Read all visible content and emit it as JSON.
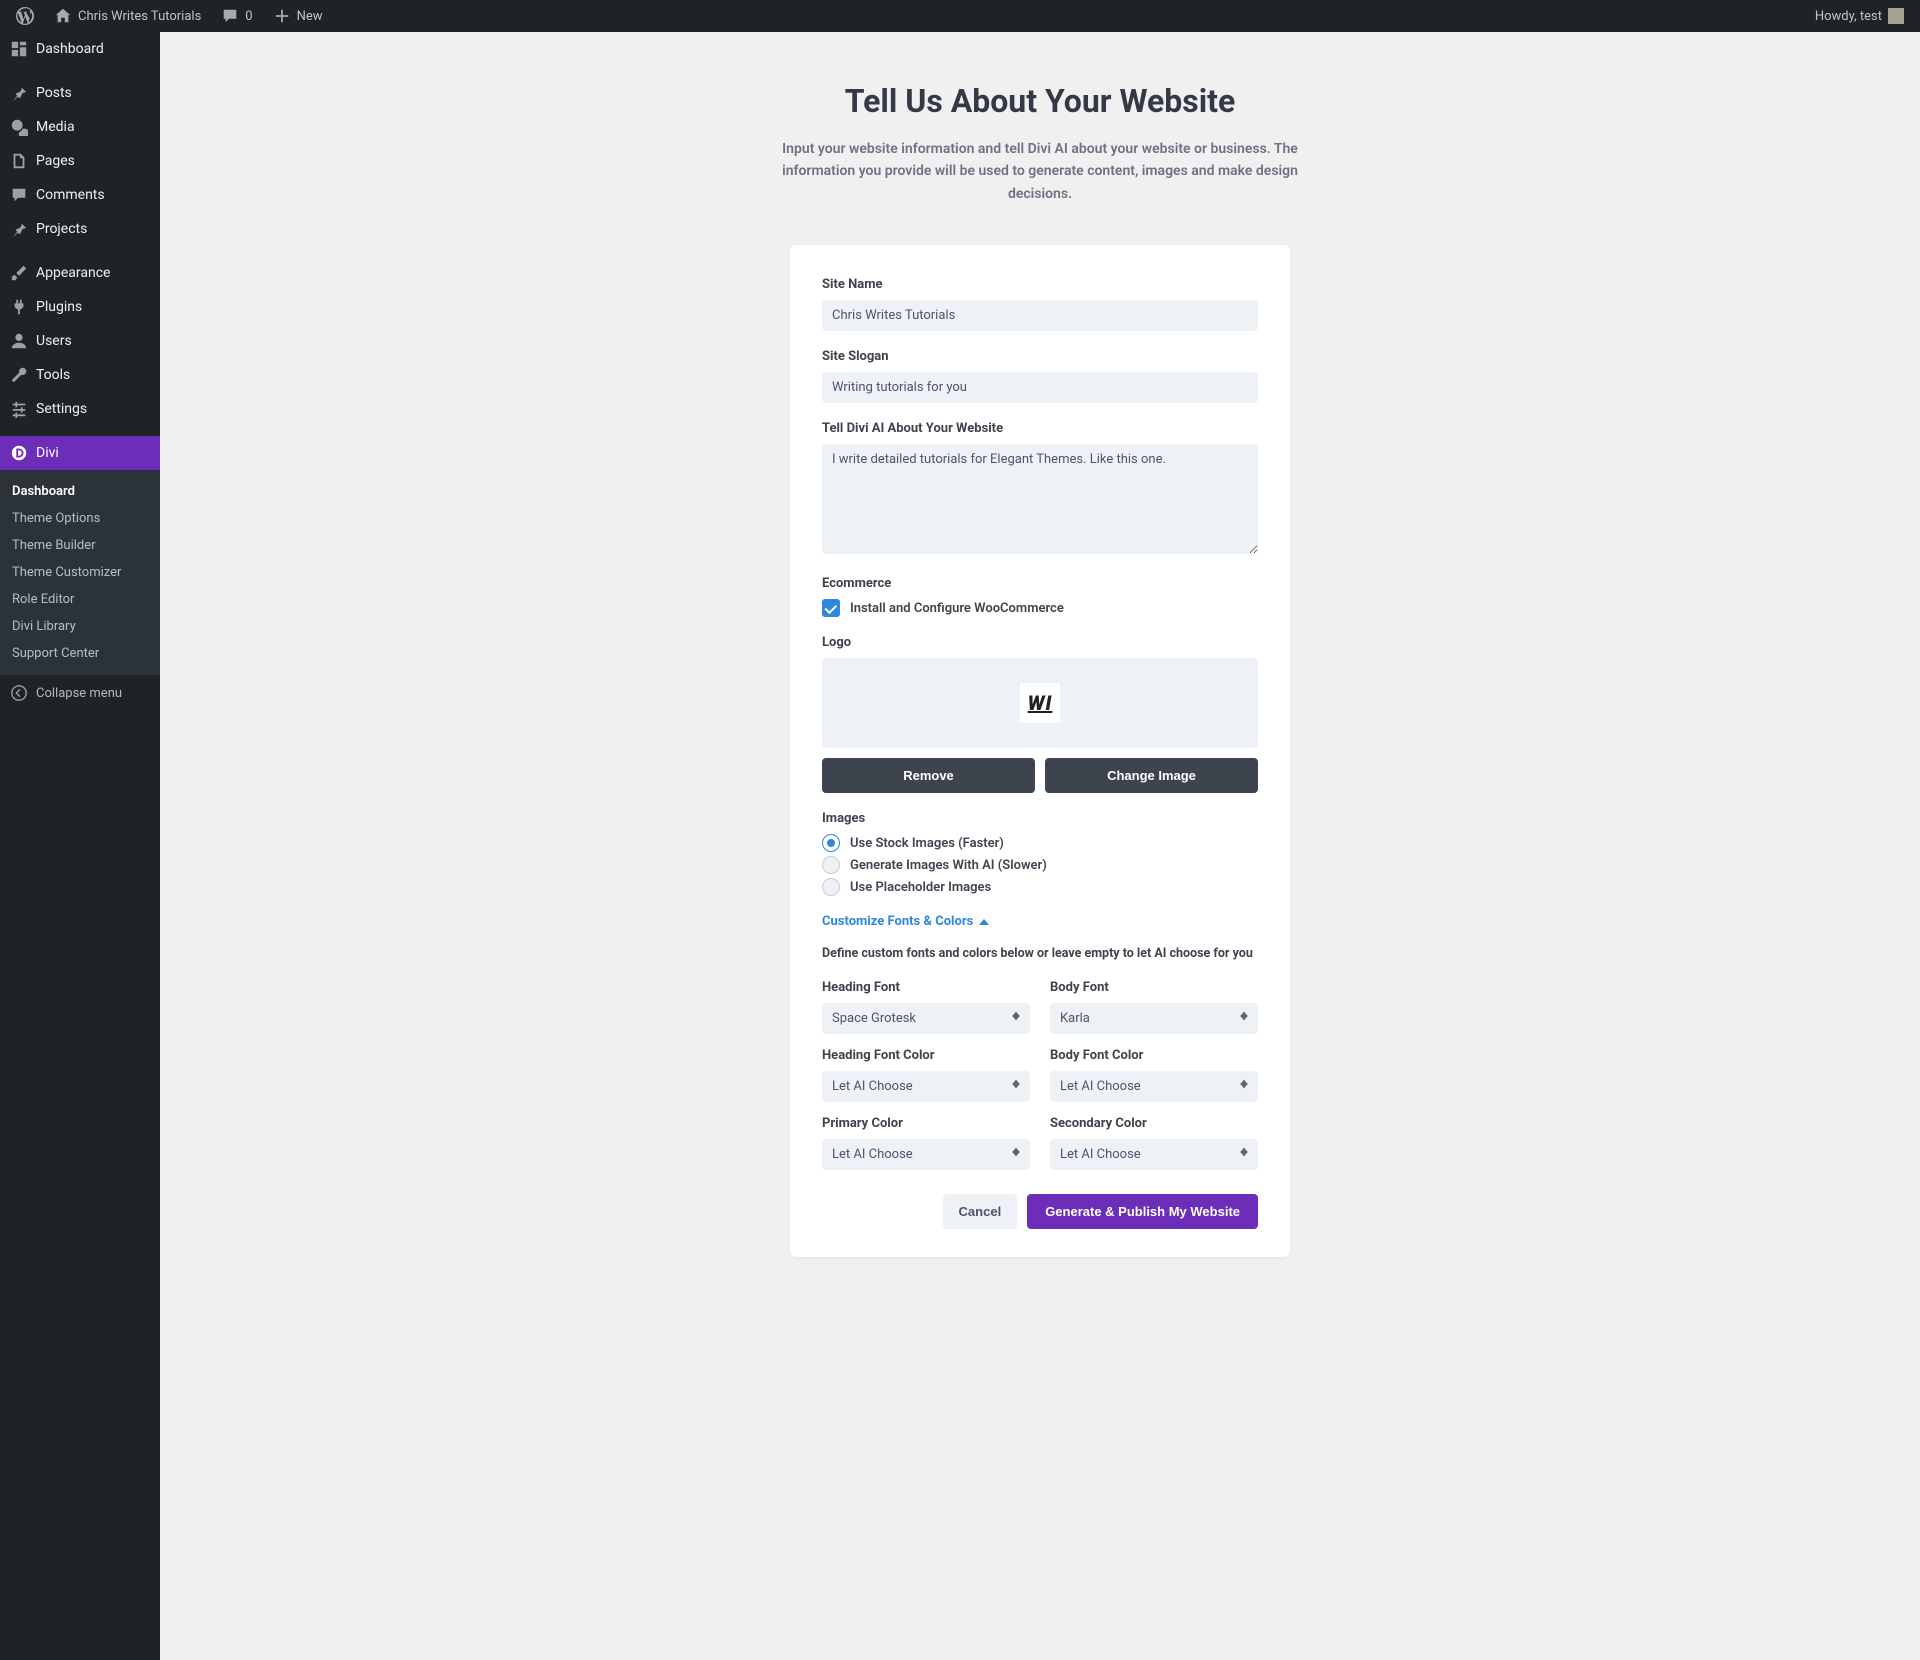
{
  "adminbar": {
    "site_name": "Chris Writes Tutorials",
    "comments_count": "0",
    "new_label": "New",
    "howdy": "Howdy, test"
  },
  "sidebar": {
    "items": [
      {
        "label": "Dashboard"
      },
      {
        "label": "Posts"
      },
      {
        "label": "Media"
      },
      {
        "label": "Pages"
      },
      {
        "label": "Comments"
      },
      {
        "label": "Projects"
      },
      {
        "label": "Appearance"
      },
      {
        "label": "Plugins"
      },
      {
        "label": "Users"
      },
      {
        "label": "Tools"
      },
      {
        "label": "Settings"
      },
      {
        "label": "Divi"
      }
    ],
    "submenu": [
      {
        "label": "Dashboard"
      },
      {
        "label": "Theme Options"
      },
      {
        "label": "Theme Builder"
      },
      {
        "label": "Theme Customizer"
      },
      {
        "label": "Role Editor"
      },
      {
        "label": "Divi Library"
      },
      {
        "label": "Support Center"
      }
    ],
    "collapse_label": "Collapse menu"
  },
  "page": {
    "title": "Tell Us About Your Website",
    "description": "Input your website information and tell Divi AI about your website or business. The information you provide will be used to generate content, images and make design decisions."
  },
  "form": {
    "site_name_label": "Site Name",
    "site_name_value": "Chris Writes Tutorials",
    "site_slogan_label": "Site Slogan",
    "site_slogan_value": "Writing tutorials for you",
    "about_label": "Tell Divi AI About Your Website",
    "about_value": "I write detailed tutorials for Elegant Themes. Like this one.",
    "ecommerce_label": "Ecommerce",
    "ecommerce_checkbox_label": "Install and Configure WooCommerce",
    "logo_label": "Logo",
    "logo_text": "WI",
    "remove_btn": "Remove",
    "change_btn": "Change Image",
    "images_label": "Images",
    "image_options": [
      {
        "label": "Use Stock Images (Faster)"
      },
      {
        "label": "Generate Images With AI (Slower)"
      },
      {
        "label": "Use Placeholder Images"
      }
    ],
    "customize_toggle": "Customize Fonts & Colors",
    "customize_helper": "Define custom fonts and colors below or leave empty to let AI choose for you",
    "heading_font_label": "Heading Font",
    "heading_font_value": "Space Grotesk",
    "body_font_label": "Body Font",
    "body_font_value": "Karla",
    "heading_color_label": "Heading Font Color",
    "heading_color_value": "Let AI Choose",
    "body_color_label": "Body Font Color",
    "body_color_value": "Let AI Choose",
    "primary_color_label": "Primary Color",
    "primary_color_value": "Let AI Choose",
    "secondary_color_label": "Secondary Color",
    "secondary_color_value": "Let AI Choose",
    "cancel_btn": "Cancel",
    "submit_btn": "Generate & Publish My Website"
  }
}
